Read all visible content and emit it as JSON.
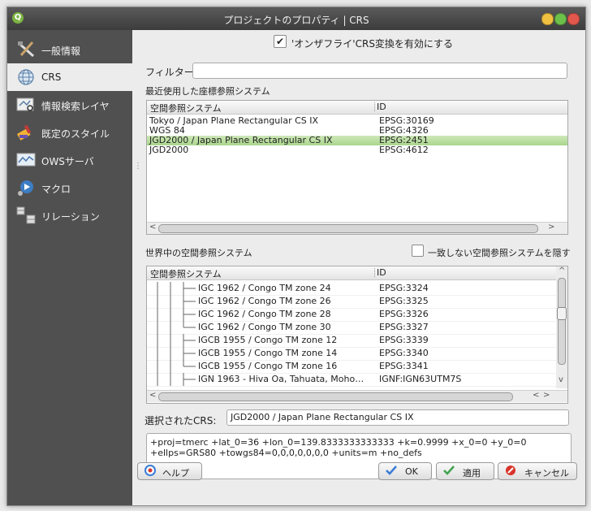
{
  "window": {
    "title": "プロジェクトのプロパティ | CRS",
    "app_icon_letter": "Q"
  },
  "sidebar": {
    "items": [
      {
        "label": "一般情報",
        "icon": "tools-icon"
      },
      {
        "label": "CRS",
        "icon": "globe-icon"
      },
      {
        "label": "情報検索レイヤ",
        "icon": "identify-layers-icon"
      },
      {
        "label": "既定のスタイル",
        "icon": "paint-brush-icon"
      },
      {
        "label": "OWSサーバ",
        "icon": "ows-server-icon"
      },
      {
        "label": "マクロ",
        "icon": "macro-icon"
      },
      {
        "label": "リレーション",
        "icon": "relations-icon"
      }
    ]
  },
  "crs": {
    "otf_checkbox": {
      "label": "'オンザフライ'CRS変換を有効にする",
      "checked": true,
      "mark": "✔"
    },
    "filter": {
      "label": "フィルター",
      "value": ""
    },
    "recent": {
      "label": "最近使用した座標参照システム",
      "columns": [
        "空間参照システム",
        "ID"
      ],
      "rows": [
        {
          "name": "Tokyo / Japan Plane Rectangular CS IX",
          "id": "EPSG:30169"
        },
        {
          "name": "WGS 84",
          "id": "EPSG:4326"
        },
        {
          "name": "JGD2000 / Japan Plane Rectangular CS IX",
          "id": "EPSG:2451",
          "selected": true
        },
        {
          "name": "JGD2000",
          "id": "EPSG:4612"
        }
      ]
    },
    "world": {
      "label": "世界中の空間参照システム",
      "hide_deprecated_label": "一致しない空間参照システムを隠す",
      "hide_deprecated_checked": false,
      "columns": [
        "空間参照システム",
        "ID"
      ],
      "rows": [
        {
          "name": "IGC 1962 / Congo TM zone 24",
          "id": "EPSG:3324"
        },
        {
          "name": "IGC 1962 / Congo TM zone 26",
          "id": "EPSG:3325"
        },
        {
          "name": "IGC 1962 / Congo TM zone 28",
          "id": "EPSG:3326"
        },
        {
          "name": "IGC 1962 / Congo TM zone 30",
          "id": "EPSG:3327"
        },
        {
          "name": "IGCB 1955 / Congo TM zone 12",
          "id": "EPSG:3339"
        },
        {
          "name": "IGCB 1955 / Congo TM zone 14",
          "id": "EPSG:3340"
        },
        {
          "name": "IGCB 1955 / Congo TM zone 16",
          "id": "EPSG:3341"
        },
        {
          "name": "IGN 1963 - Hiva Oa, Tahuata, Moho…",
          "id": "IGNF:IGN63UTM7S"
        }
      ]
    },
    "selected_crs": {
      "label": "選択されたCRS:",
      "value": "JGD2000 / Japan Plane Rectangular CS IX"
    },
    "proj_string": {
      "line1": "+proj=tmerc +lat_0=36 +lon_0=139.8333333333333 +k=0.9999 +x_0=0 +y_0=0",
      "line2": "+ellps=GRS80 +towgs84=0,0,0,0,0,0,0 +units=m +no_defs"
    }
  },
  "buttons": {
    "help": "ヘルプ",
    "ok": "OK",
    "apply": "適用",
    "cancel": "キャンセル"
  },
  "scroll_glyphs": {
    "left": "<",
    "right": ">",
    "up": "^",
    "down": "v",
    "handle": "⋮"
  },
  "colors": {
    "selection": "#b5dd9d",
    "sidebar": "#505050",
    "cancel_icon": "#d9342b",
    "check_icon": "#3a7bd5"
  }
}
